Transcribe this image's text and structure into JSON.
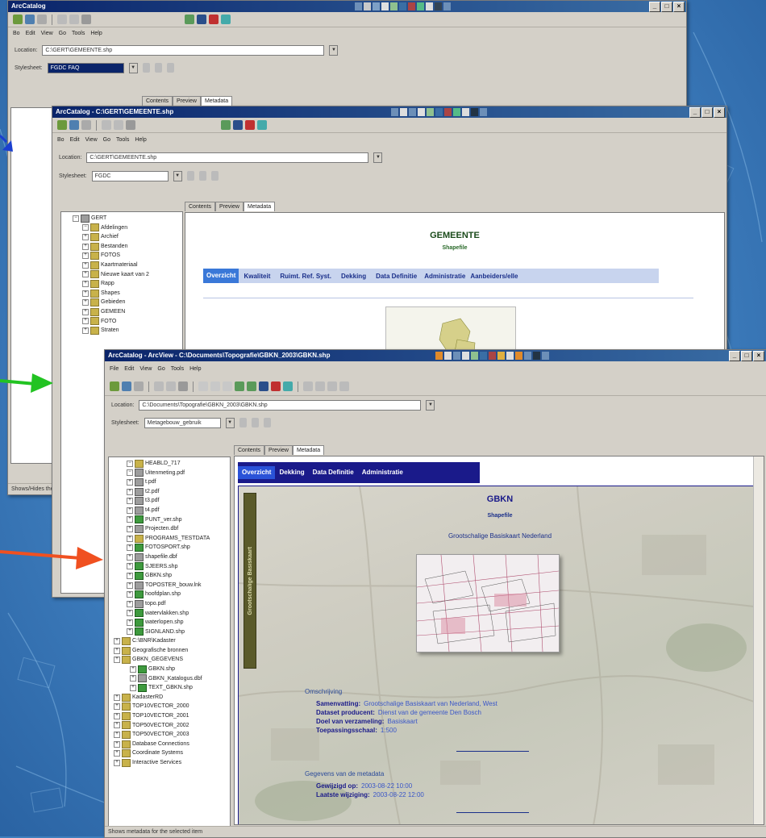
{
  "w1": {
    "title": "ArcCatalog",
    "menu": [
      "Bo",
      "Edit",
      "View",
      "Go",
      "Tools",
      "Help"
    ],
    "location_label": "Location:",
    "location_value": "C:\\GERT\\GEMEENTE.shp",
    "stylesheet_label": "Stylesheet:",
    "stylesheet_value": "FGDC FAQ",
    "tabs": [
      "Contents",
      "Preview",
      "Metadata"
    ],
    "status": "Shows/Hides the"
  },
  "w2": {
    "title": "ArcCatalog - C:\\GERT\\GEMEENTE.shp",
    "menu": [
      "Bo",
      "Edit",
      "View",
      "Go",
      "Tools",
      "Help"
    ],
    "location_label": "Location:",
    "location_value": "C:\\GERT\\GEMEENTE.shp",
    "stylesheet_label": "Stylesheet:",
    "stylesheet_value": "FGDC",
    "tabs": [
      "Contents",
      "Preview",
      "Metadata"
    ],
    "tree": [
      "GERT",
      "Afdelingen",
      "Archief",
      "Bestanden",
      "FOTOS",
      "Kaartmateriaal",
      "Nieuwe kaart van 2",
      "Rapp",
      "Shapes",
      "Gebieden",
      "GEMEEN",
      "FOTO",
      "Straten"
    ],
    "heading": "GEMEENTE",
    "subheading": "Shapefile",
    "meta_tabs": [
      "Overzicht",
      "Kwaliteit",
      "Ruimt. Ref. Syst.",
      "Dekking",
      "Data Definitie",
      "Administratie",
      "Aanbeiders/elle"
    ]
  },
  "w3": {
    "title": "ArcCatalog - ArcView - C:\\Documents\\Topografie\\GBKN_2003\\GBKN.shp",
    "menu": [
      "File",
      "Edit",
      "View",
      "Go",
      "Tools",
      "Help"
    ],
    "location_label": "Location:",
    "location_value": "C:\\Documents\\Topografie\\GBKN_2003\\GBKN.shp",
    "stylesheet_label": "Stylesheet:",
    "stylesheet_value": "Metagebouw_gebruik",
    "tabs": [
      "Contents",
      "Preview",
      "Metadata"
    ],
    "tree": [
      "HEABLD_717",
      "Uitenmeting.pdf",
      "t.pdf",
      "t2.pdf",
      "t3.pdf",
      "t4.pdf",
      "PUNT_ver.shp",
      "Projecten.dbf",
      "PROGRAMS_TESTDATA",
      "FOTOSPORT.shp",
      "shapefile.dbf",
      "SJEERS.shp",
      "GBKN.shp",
      "TOPOSTER_bouw.lnk",
      "hoofdplan.shp",
      "topo.pdf",
      "watervlakken.shp",
      "waterlopen.shp",
      "SIGNLAND.shp",
      "C:\\BNR\\Kadaster",
      "Geografische bronnen",
      "GBKN_GEGEVENS",
      "GBKN.shp",
      "GBKN_Katalogus.dbf",
      "TEXT_GBKN.shp",
      "KadasterRD",
      "TOP10VECTOR_2000",
      "TOP10VECTOR_2001",
      "TOP50VECTOR_2002",
      "TOP50VECTOR_2003",
      "Database Connections",
      "Coordinate Systems",
      "Interactive Services"
    ],
    "side_label": "Grootschalige Basiskaart",
    "meta_tabs": [
      "Overzicht",
      "Dekking",
      "Data Definitie",
      "Administratie"
    ],
    "doc": {
      "title": "GBKN",
      "subtitle": "Shapefile",
      "desc": "Grootschalige Basiskaart Nederland",
      "section1": "Omschrijving",
      "lines1": [
        {
          "k": "Samenvatting:",
          "v": "Grootschalige Basiskaart van Nederland, West"
        },
        {
          "k": "Dataset producent:",
          "v": "Dienst van de gemeente Den Bosch"
        },
        {
          "k": "Doel van verzameling:",
          "v": "Basiskaart"
        },
        {
          "k": "Toepassingsschaal:",
          "v": "1:500"
        }
      ],
      "section2": "Gegevens van de metadata",
      "lines2": [
        {
          "k": "Gewijzigd op:",
          "v": "2003-08-22 10:00"
        },
        {
          "k": "Laatste wijziging:",
          "v": "2003-08-22 12:00"
        }
      ]
    },
    "status": "Shows metadata for the selected item"
  },
  "colors": {
    "background": "#3f7fbd",
    "arrow_blue": "#1a3fd0",
    "arrow_green": "#22c322",
    "arrow_red": "#f05020",
    "titlebar": "#0a246a"
  }
}
